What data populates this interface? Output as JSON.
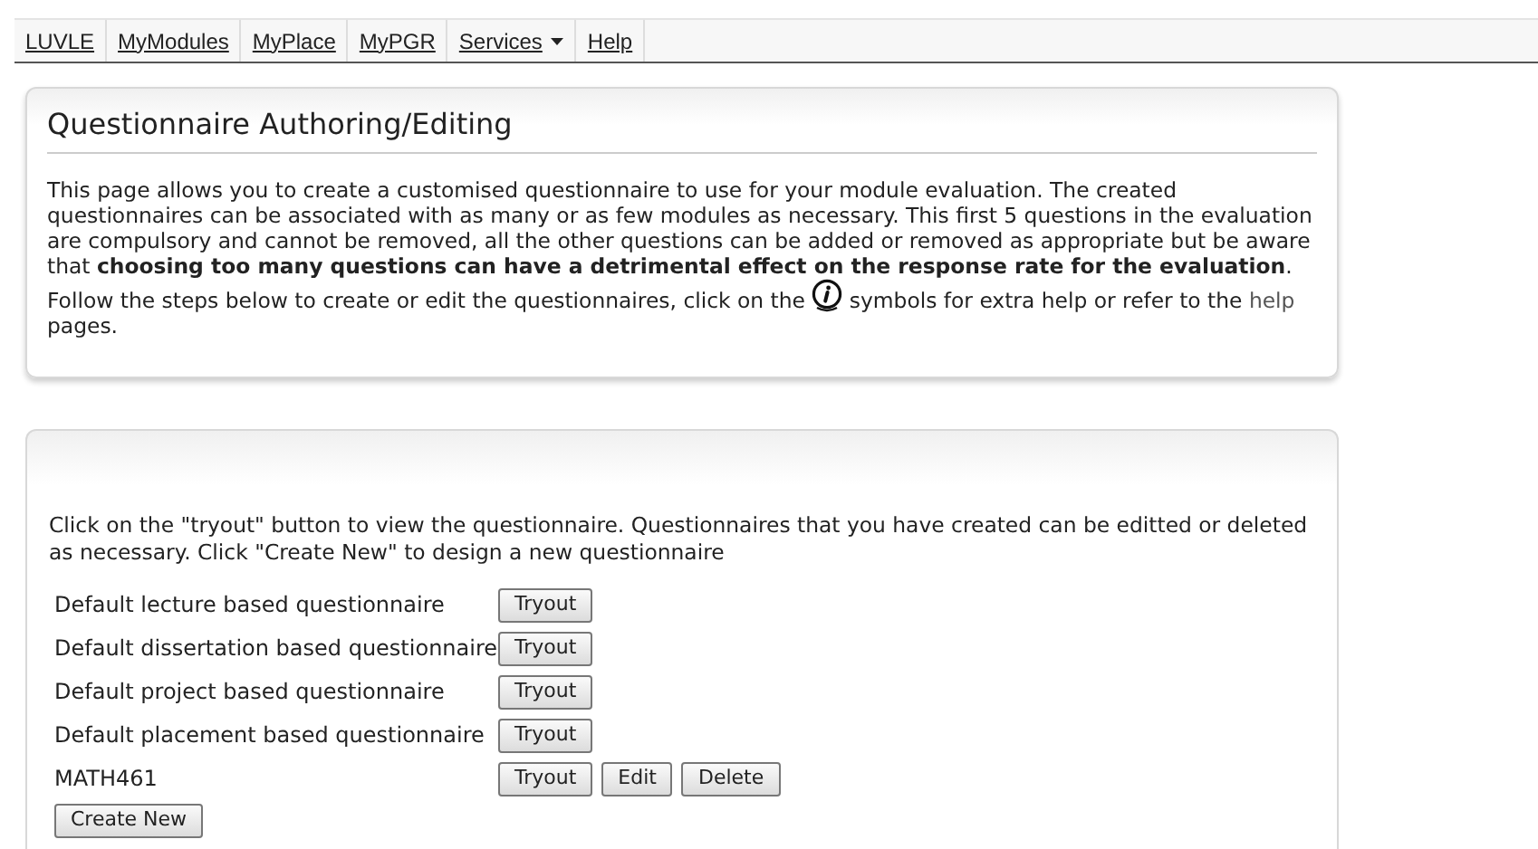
{
  "nav": [
    {
      "label": "LUVLE",
      "kind": "link"
    },
    {
      "label": "MyModules",
      "kind": "link"
    },
    {
      "label": "MyPlace",
      "kind": "link"
    },
    {
      "label": "MyPGR",
      "kind": "link"
    },
    {
      "label": "Services",
      "kind": "dropdown"
    },
    {
      "label": "Help",
      "kind": "link"
    }
  ],
  "intro": {
    "title": "Questionnaire Authoring/Editing",
    "text_before_icon": "This page allows you to create a customised questionnaire to use for your module evaluation. The created questionnaires can be associated with as many or as few modules as necessary. This first 5 questions in the evaluation are compulsory and cannot be removed, all the other questions can be added or removed as appropriate but be aware that **choosing too many questions can have a detrimental effect on the response rate for the evaluation**. Follow the steps below to create or edit the questionnaires, click on the",
    "text_after_icon": "symbols for extra help or refer to the",
    "link": "help",
    "text_end": "pages."
  },
  "list_panel": {
    "instructions": "Click on the \"tryout\" button to view the questionnaire. Questionnaires that you have created can be editted or deleted as necessary. Click \"Create New\" to design a new questionnaire",
    "questionnaires": [
      {
        "name": "Default lecture based questionnaire",
        "actions": [
          "Tryout"
        ]
      },
      {
        "name": "Default dissertation based questionnaire",
        "actions": [
          "Tryout"
        ]
      },
      {
        "name": "Default project based questionnaire",
        "actions": [
          "Tryout"
        ]
      },
      {
        "name": "Default placement based questionnaire",
        "actions": [
          "Tryout"
        ]
      },
      {
        "name": "MATH461",
        "actions": [
          "Tryout",
          "Edit",
          "Delete"
        ]
      }
    ],
    "create_button": "Create New"
  }
}
